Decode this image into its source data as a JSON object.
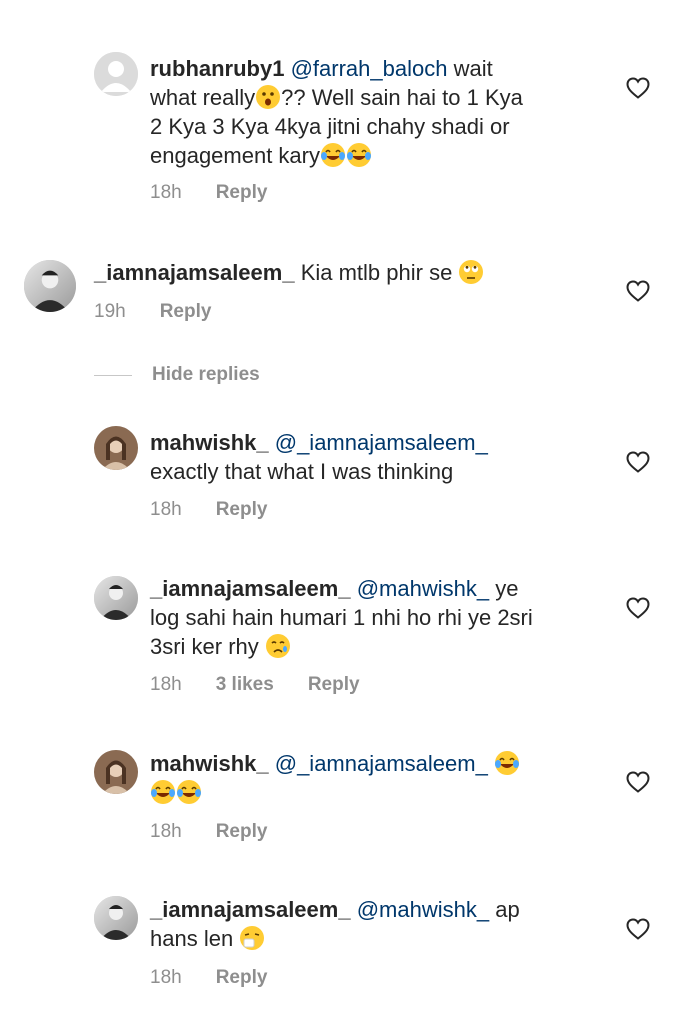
{
  "comments": [
    {
      "username": "rubhanruby1",
      "mention": "@farrah_baloch",
      "line1_rest": " wait",
      "line2a": "what really",
      "line2b": "?? Well sain hai to 1 Kya",
      "line3": "2 Kya 3 Kya 4kya jitni chahy shadi or",
      "line4": "engagement kary",
      "time": "18h",
      "reply": "Reply"
    },
    {
      "username": "_iamnajamsaleem_",
      "text": " Kia mtlb phir se ",
      "time": "19h",
      "reply": "Reply"
    },
    {
      "username": "mahwishk_",
      "mention": "@_iamnajamsaleem_",
      "line2": "exactly that what I was thinking",
      "time": "18h",
      "reply": "Reply"
    },
    {
      "username": "_iamnajamsaleem_",
      "mention": "@mahwishk_",
      "line1_rest": " ye",
      "line2": "log sahi hain humari 1 nhi ho rhi ye 2sri",
      "line3": "3sri ker rhy ",
      "time": "18h",
      "likes": "3 likes",
      "reply": "Reply"
    },
    {
      "username": "mahwishk_",
      "mention": "@_iamnajamsaleem_",
      "time": "18h",
      "reply": "Reply"
    },
    {
      "username": "_iamnajamsaleem_",
      "mention": "@mahwishk_",
      "line1_rest": " ap",
      "line2": "hans len ",
      "time": "18h",
      "reply": "Reply"
    }
  ],
  "hide_replies": "Hide replies",
  "icons": {
    "like": "heart-outline-icon",
    "laugh": "face-with-tears-of-joy-emoji",
    "surprised": "hushed-face-emoji",
    "eyeroll": "face-with-rolling-eyes-emoji",
    "cry": "crying-face-emoji",
    "sneeze": "sneezing-face-emoji"
  },
  "colors": {
    "mention": "#00376b",
    "meta": "#8e8e8e",
    "text": "#262626"
  }
}
